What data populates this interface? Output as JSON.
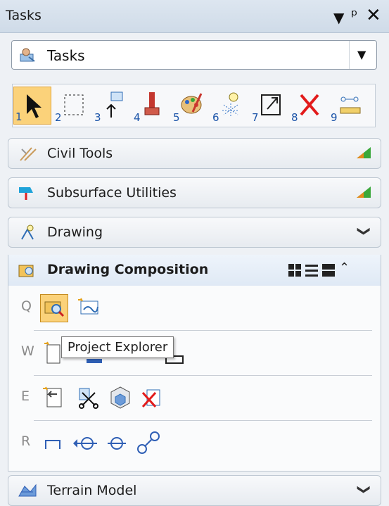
{
  "titlebar": {
    "title": "Tasks",
    "dropdown_icon": "triangle-down-icon",
    "pin_icon": "pin-icon",
    "close_icon": "close-icon"
  },
  "task_selector": {
    "value": "Tasks",
    "icon": "tasks-icon"
  },
  "toolbar": {
    "tools": [
      {
        "num": "1",
        "icon": "select-arrow-icon",
        "active": true
      },
      {
        "num": "2",
        "icon": "selection-box-icon"
      },
      {
        "num": "3",
        "icon": "place-element-icon"
      },
      {
        "num": "4",
        "icon": "brush-icon"
      },
      {
        "num": "5",
        "icon": "palette-icon"
      },
      {
        "num": "6",
        "icon": "bulb-icon"
      },
      {
        "num": "7",
        "icon": "scale-box-icon"
      },
      {
        "num": "8",
        "icon": "delete-x-icon"
      },
      {
        "num": "9",
        "icon": "measure-icon"
      }
    ]
  },
  "sections": {
    "civil_tools": "Civil Tools",
    "subsurface": "Subsurface Utilities",
    "drawing": "Drawing",
    "drawing_composition": "Drawing Composition",
    "terrain_model": "Terrain Model"
  },
  "rows": {
    "q": "Q",
    "w": "W",
    "e": "E",
    "r": "R"
  },
  "tooltip": "Project Explorer"
}
